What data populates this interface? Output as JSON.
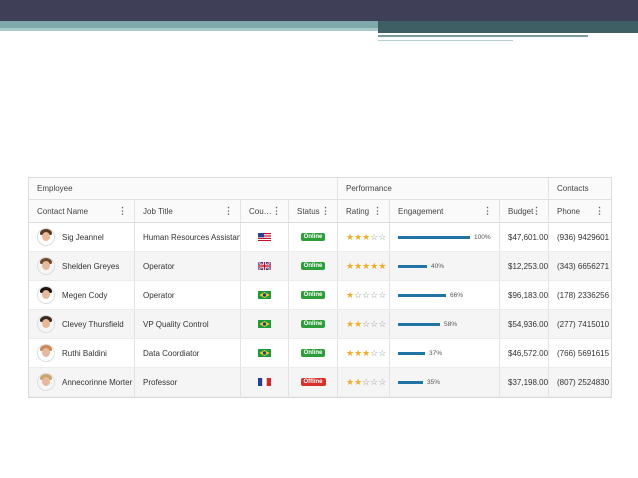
{
  "slide": {
    "colors": {
      "top": "#3f3f57",
      "teal": "#7ea8aa"
    }
  },
  "grid": {
    "groups": {
      "employee": "Employee",
      "performance": "Performance",
      "contacts": "Contacts"
    },
    "columns": {
      "name": "Contact Name",
      "job": "Job Title",
      "country": "Cou…",
      "status": "Status",
      "rating": "Rating",
      "engagement": "Engagement",
      "budget": "Budget",
      "phone": "Phone"
    },
    "menu_glyph": "⋮",
    "rows": [
      {
        "name": "Sig Jeannel",
        "job": "Human Resources Assistant III",
        "country": "us-flag-icon",
        "status": "Online",
        "rating": 3,
        "engagement": 100,
        "engagement_label": "100%",
        "budget": "$47,601.00",
        "phone": "(936) 9429601",
        "hair": "#5a3a22"
      },
      {
        "name": "Shelden Greyes",
        "job": "Operator",
        "country": "uk-flag-icon",
        "status": "Online",
        "rating": 5,
        "engagement": 40,
        "engagement_label": "40%",
        "budget": "$12,253.00",
        "phone": "(343) 6656271",
        "hair": "#6b4a30"
      },
      {
        "name": "Megen Cody",
        "job": "Operator",
        "country": "brazil-flag-icon",
        "status": "Online",
        "rating": 1,
        "engagement": 66,
        "engagement_label": "66%",
        "budget": "$96,183.00",
        "phone": "(178) 2336256",
        "hair": "#1e1410"
      },
      {
        "name": "Clevey Thursfield",
        "job": "VP Quality Control",
        "country": "brazil-flag-icon",
        "status": "Online",
        "rating": 2,
        "engagement": 58,
        "engagement_label": "58%",
        "budget": "$54,936.00",
        "phone": "(277) 7415010",
        "hair": "#3a2a1e"
      },
      {
        "name": "Ruthi Baldini",
        "job": "Data Coordiator",
        "country": "brazil-flag-icon",
        "status": "Online",
        "rating": 3,
        "engagement": 37,
        "engagement_label": "37%",
        "budget": "$46,572.00",
        "phone": "(766) 5691615",
        "hair": "#c98a5a"
      },
      {
        "name": "Annecorinne Morter",
        "job": "Professor",
        "country": "france-flag-icon",
        "status": "Offline",
        "rating": 2,
        "engagement": 35,
        "engagement_label": "35%",
        "budget": "$37,198.00",
        "phone": "(807) 2524830",
        "hair": "#c9a56a"
      }
    ],
    "status_colors": {
      "Online": "#2e9e3a",
      "Offline": "#d9302c"
    }
  }
}
